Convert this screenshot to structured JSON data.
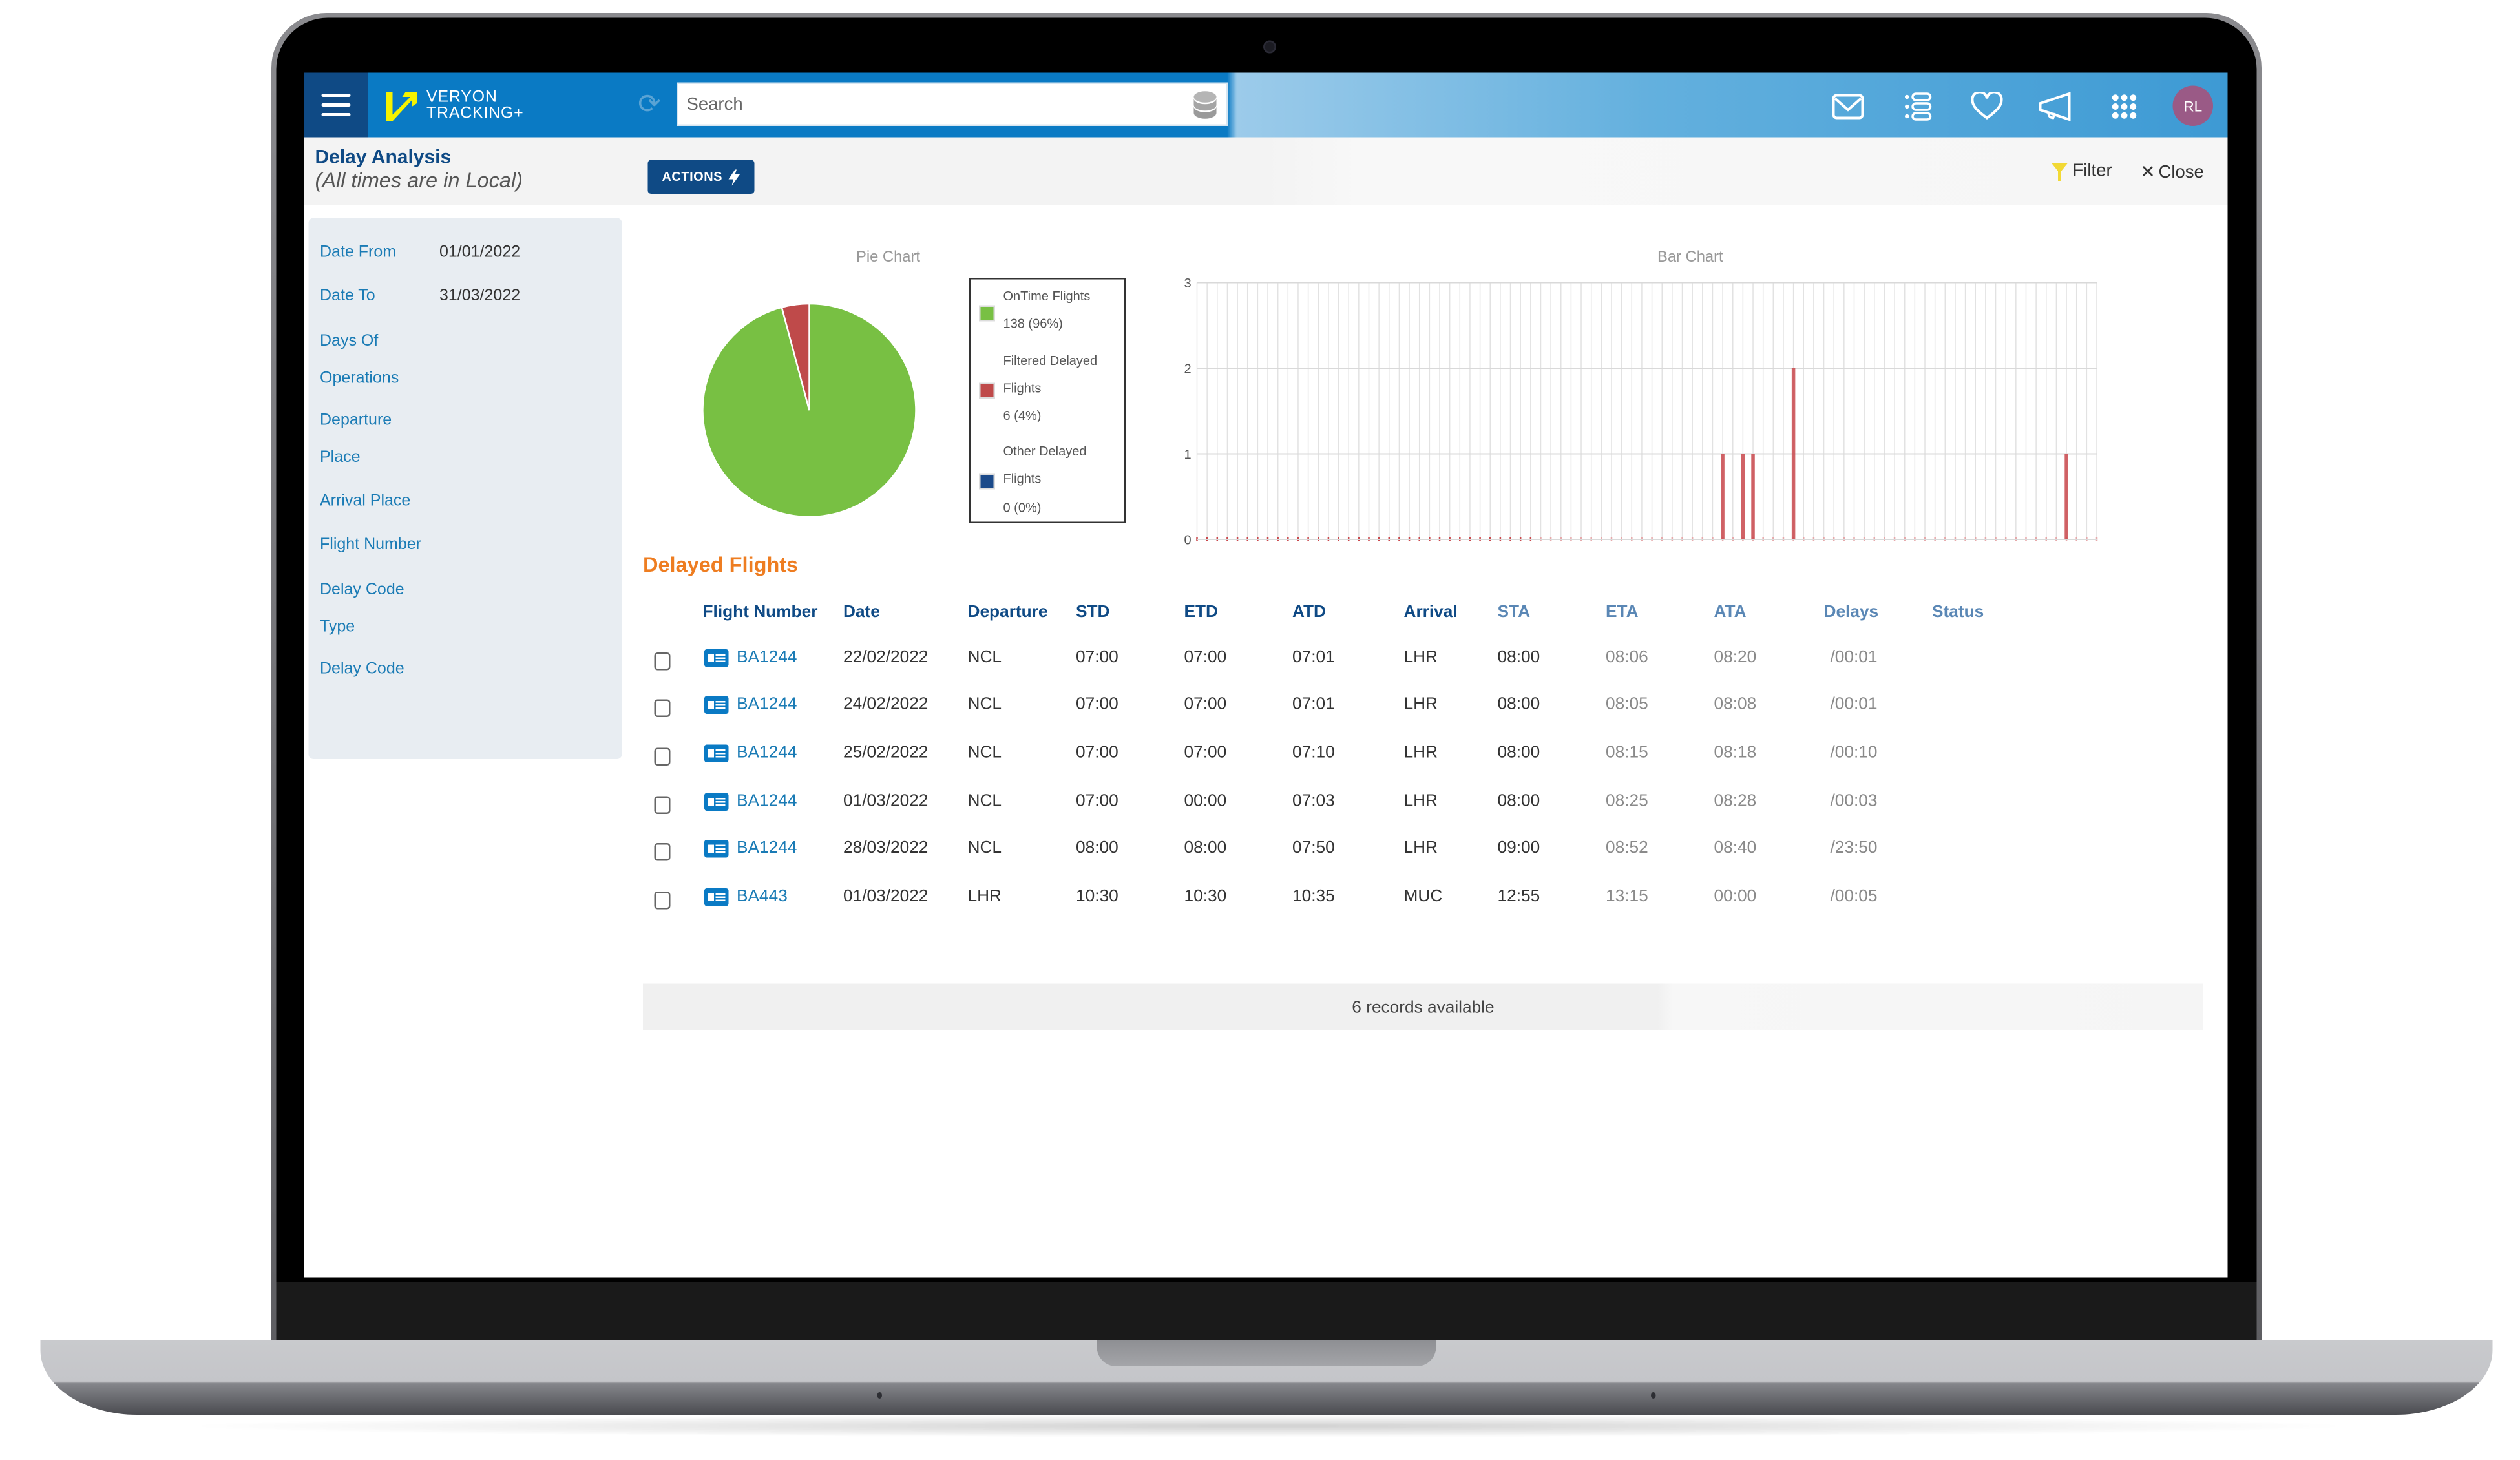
{
  "app": {
    "logo_line1": "VERYON",
    "logo_line2": "TRACKING+",
    "brand_primary": "#0a7ac4",
    "brand_dark": "#0f4a85",
    "logo_accent": "#f5f200"
  },
  "header": {
    "search_placeholder": "Search",
    "icons": [
      "menu-icon",
      "refresh-icon",
      "database-icon",
      "mail-icon",
      "list-icon",
      "heart-icon",
      "megaphone-icon",
      "apps-grid-icon"
    ],
    "avatar_initials": "RL",
    "avatar_color": "#9a5a86"
  },
  "subheader": {
    "title": "Delay Analysis",
    "subtitle": "(All times are in Local)",
    "actions_label": "ACTIONS",
    "filter_label": "Filter",
    "close_label": "Close"
  },
  "filters": {
    "items": [
      {
        "label": "Date From",
        "value": "01/01/2022"
      },
      {
        "label": "Date To",
        "value": "31/03/2022"
      },
      {
        "label": "Days Of Operations",
        "value": ""
      },
      {
        "label": "Departure Place",
        "value": ""
      },
      {
        "label": "Arrival Place",
        "value": ""
      },
      {
        "label": "Flight Number",
        "value": ""
      },
      {
        "label": "Delay Code Type",
        "value": ""
      },
      {
        "label": "Delay Code",
        "value": ""
      }
    ]
  },
  "chart_data": [
    {
      "type": "pie",
      "title": "Pie Chart",
      "categories": [
        "OnTime Flights",
        "Filtered Delayed Flights",
        "Other Delayed Flights"
      ],
      "values": [
        138,
        6,
        0
      ],
      "percent_labels": [
        "138 (96%)",
        "6 (4%)",
        "0 (0%)"
      ],
      "colors": [
        "#78c043",
        "#bf4a4a",
        "#1b4a8a"
      ],
      "legend_position": "right"
    },
    {
      "type": "bar",
      "title": "Bar Chart",
      "x_start_date": "01/01/2022",
      "x_end_date": "31/03/2022",
      "x_count": 90,
      "series": [
        {
          "name": "Filtered Delayed Flights",
          "color": "#c9484c",
          "points": [
            {
              "date": "22/02/2022",
              "index": 52,
              "value": 1
            },
            {
              "date": "24/02/2022",
              "index": 54,
              "value": 1
            },
            {
              "date": "25/02/2022",
              "index": 55,
              "value": 1
            },
            {
              "date": "01/03/2022",
              "index": 59,
              "value": 2
            },
            {
              "date": "28/03/2022",
              "index": 86,
              "value": 1
            }
          ]
        }
      ],
      "yticks": [
        "0",
        "1",
        "2",
        "3"
      ],
      "ylim": [
        0,
        3
      ],
      "xlabel": "",
      "ylabel": "",
      "grid": true
    }
  ],
  "table": {
    "title": "Delayed Flights",
    "columns": [
      "Flight Number",
      "Date",
      "Departure",
      "STD",
      "ETD",
      "ATD",
      "Arrival",
      "STA",
      "ETA",
      "ATA",
      "Delays",
      "Status"
    ],
    "rows": [
      {
        "flight": "BA1244",
        "date": "22/02/2022",
        "dep": "NCL",
        "std": "07:00",
        "etd": "07:00",
        "atd": "07:01",
        "arr": "LHR",
        "sta": "08:00",
        "eta": "08:06",
        "ata": "08:20",
        "delays": "/00:01",
        "status": ""
      },
      {
        "flight": "BA1244",
        "date": "24/02/2022",
        "dep": "NCL",
        "std": "07:00",
        "etd": "07:00",
        "atd": "07:01",
        "arr": "LHR",
        "sta": "08:00",
        "eta": "08:05",
        "ata": "08:08",
        "delays": "/00:01",
        "status": ""
      },
      {
        "flight": "BA1244",
        "date": "25/02/2022",
        "dep": "NCL",
        "std": "07:00",
        "etd": "07:00",
        "atd": "07:10",
        "arr": "LHR",
        "sta": "08:00",
        "eta": "08:15",
        "ata": "08:18",
        "delays": "/00:10",
        "status": ""
      },
      {
        "flight": "BA1244",
        "date": "01/03/2022",
        "dep": "NCL",
        "std": "07:00",
        "etd": "00:00",
        "atd": "07:03",
        "arr": "LHR",
        "sta": "08:00",
        "eta": "08:25",
        "ata": "08:28",
        "delays": "/00:03",
        "status": ""
      },
      {
        "flight": "BA1244",
        "date": "28/03/2022",
        "dep": "NCL",
        "std": "08:00",
        "etd": "08:00",
        "atd": "07:50",
        "arr": "LHR",
        "sta": "09:00",
        "eta": "08:52",
        "ata": "08:40",
        "delays": "/23:50",
        "status": ""
      },
      {
        "flight": "BA443",
        "date": "01/03/2022",
        "dep": "LHR",
        "std": "10:30",
        "etd": "10:30",
        "atd": "10:35",
        "arr": "MUC",
        "sta": "12:55",
        "eta": "13:15",
        "ata": "00:00",
        "delays": "/00:05",
        "status": ""
      }
    ],
    "footer": "6 records available"
  }
}
